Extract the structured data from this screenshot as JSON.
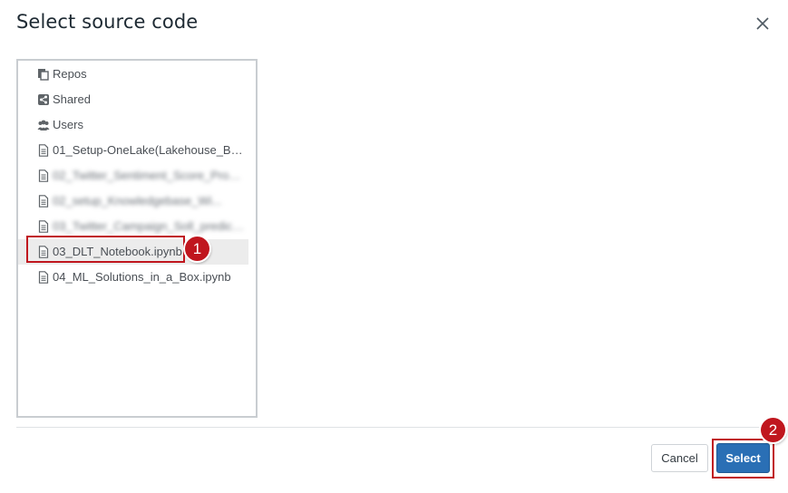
{
  "dialog": {
    "title": "Select source code",
    "close_icon": "close-icon"
  },
  "tree": {
    "items": [
      {
        "label": "Repos",
        "icon": "repos-icon",
        "blurred": false
      },
      {
        "label": "Shared",
        "icon": "share-icon",
        "blurred": false
      },
      {
        "label": "Users",
        "icon": "users-icon",
        "blurred": false
      },
      {
        "label": "01_Setup-OneLake(Lakehouse_Bro...",
        "icon": "file-icon",
        "blurred": false
      },
      {
        "label": "02_Twitter_Sentiment_Score_Prod...",
        "icon": "file-icon",
        "blurred": true
      },
      {
        "label": "02_setup_Knowledgebase_Wi...",
        "icon": "file-icon",
        "blurred": true
      },
      {
        "label": "03_Twitter_Campaign_Soll_prediction...",
        "icon": "file-icon",
        "blurred": true
      },
      {
        "label": "03_DLT_Notebook.ipynb",
        "icon": "file-icon",
        "blurred": false,
        "selected": true
      },
      {
        "label": "04_ML_Solutions_in_a_Box.ipynb",
        "icon": "file-icon",
        "blurred": false
      }
    ]
  },
  "annotations": {
    "step1": "1",
    "step2": "2",
    "color": "#c0161e"
  },
  "footer": {
    "cancel_label": "Cancel",
    "select_label": "Select",
    "select_color": "#2a6fb5"
  }
}
